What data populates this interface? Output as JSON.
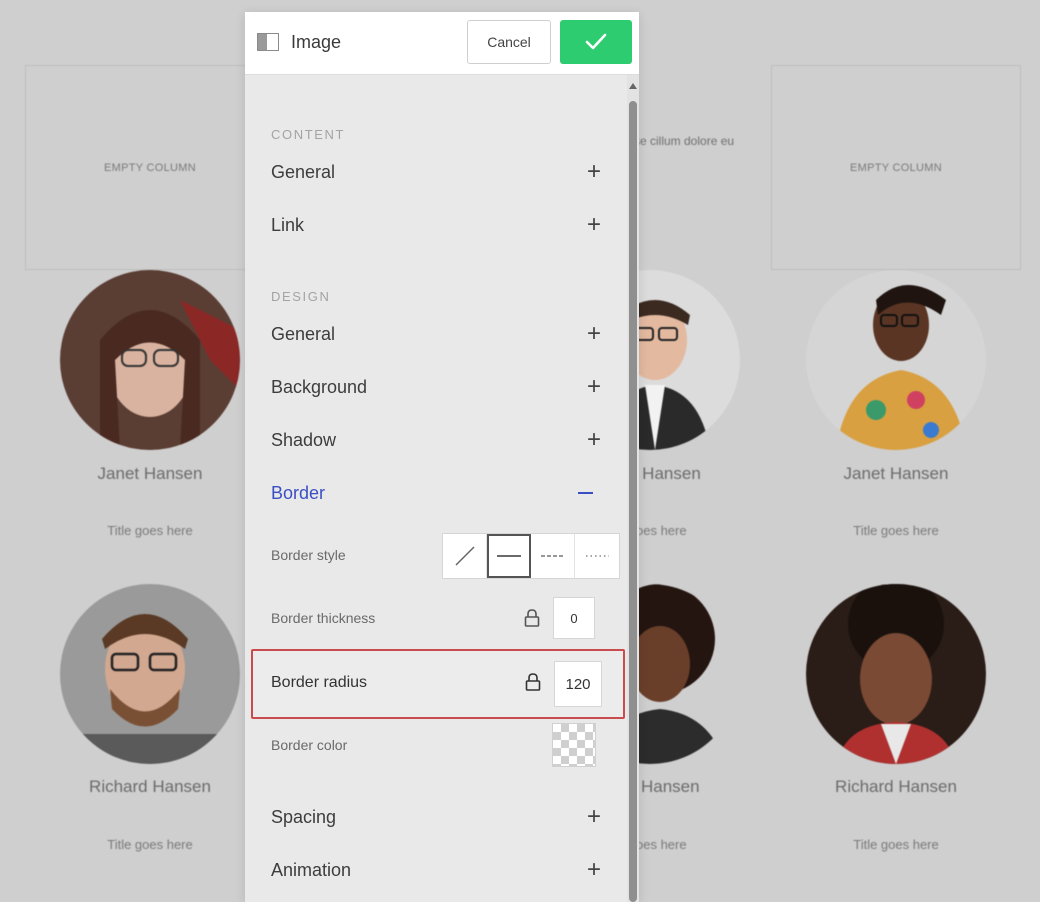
{
  "background": {
    "empty_column_label_1": "EMPTY COLUMN",
    "empty_column_label_2": "EMPTY COLUMN",
    "snippet_text": "se cillum dolore eu",
    "people": [
      {
        "name": "Janet Hansen",
        "title": "Title goes here"
      },
      {
        "name": "d Hansen",
        "title": "oes here"
      },
      {
        "name": "Janet Hansen",
        "title": "Title goes here"
      },
      {
        "name": "Richard Hansen",
        "title": "Title goes here"
      },
      {
        "name": "Hansen",
        "title": "oes here"
      },
      {
        "name": "Richard Hansen",
        "title": "Title goes here"
      }
    ]
  },
  "panel": {
    "title": "Image",
    "cancel_label": "Cancel",
    "content_section": "CONTENT",
    "content_items": [
      "General",
      "Link"
    ],
    "design_section": "DESIGN",
    "design_items": [
      "General",
      "Background",
      "Shadow"
    ],
    "active_item": "Border",
    "border_settings": {
      "style_label": "Border style",
      "style_options": [
        "none",
        "solid",
        "dashed",
        "dotted"
      ],
      "style_selected": "solid",
      "thickness_label": "Border thickness",
      "thickness_value": "0",
      "radius_label": "Border radius",
      "radius_value": "120",
      "color_label": "Border color",
      "color_value": "transparent"
    },
    "after_items": [
      "Spacing",
      "Animation"
    ],
    "plus_symbol": "+"
  },
  "colors": {
    "confirm_button": "#2ecc71",
    "active_accent": "#3b4fc4",
    "highlight_border": "#c94b4b"
  },
  "icons": {
    "header": "layout-icon",
    "confirm": "check-icon",
    "lock": "lock-icon"
  }
}
